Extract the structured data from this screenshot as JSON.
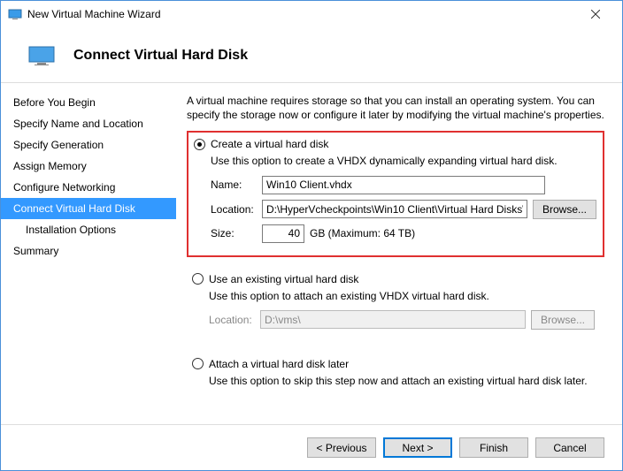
{
  "window": {
    "title": "New Virtual Machine Wizard"
  },
  "header": {
    "title": "Connect Virtual Hard Disk"
  },
  "sidebar": {
    "items": [
      {
        "label": "Before You Begin"
      },
      {
        "label": "Specify Name and Location"
      },
      {
        "label": "Specify Generation"
      },
      {
        "label": "Assign Memory"
      },
      {
        "label": "Configure Networking"
      },
      {
        "label": "Connect Virtual Hard Disk"
      },
      {
        "label": "Installation Options"
      },
      {
        "label": "Summary"
      }
    ]
  },
  "main": {
    "intro": "A virtual machine requires storage so that you can install an operating system. You can specify the storage now or configure it later by modifying the virtual machine's properties.",
    "create": {
      "radio_label": "Create a virtual hard disk",
      "desc": "Use this option to create a VHDX dynamically expanding virtual hard disk.",
      "name_label": "Name:",
      "name_value": "Win10 Client.vhdx",
      "location_label": "Location:",
      "location_value": "D:\\HyperVcheckpoints\\Win10 Client\\Virtual Hard Disks\\",
      "browse_label": "Browse...",
      "size_label": "Size:",
      "size_value": "40",
      "size_suffix": "GB (Maximum: 64 TB)"
    },
    "existing": {
      "radio_label": "Use an existing virtual hard disk",
      "desc": "Use this option to attach an existing VHDX virtual hard disk.",
      "location_label": "Location:",
      "location_value": "D:\\vms\\",
      "browse_label": "Browse..."
    },
    "later": {
      "radio_label": "Attach a virtual hard disk later",
      "desc": "Use this option to skip this step now and attach an existing virtual hard disk later."
    }
  },
  "footer": {
    "previous": "< Previous",
    "next": "Next >",
    "finish": "Finish",
    "cancel": "Cancel"
  }
}
